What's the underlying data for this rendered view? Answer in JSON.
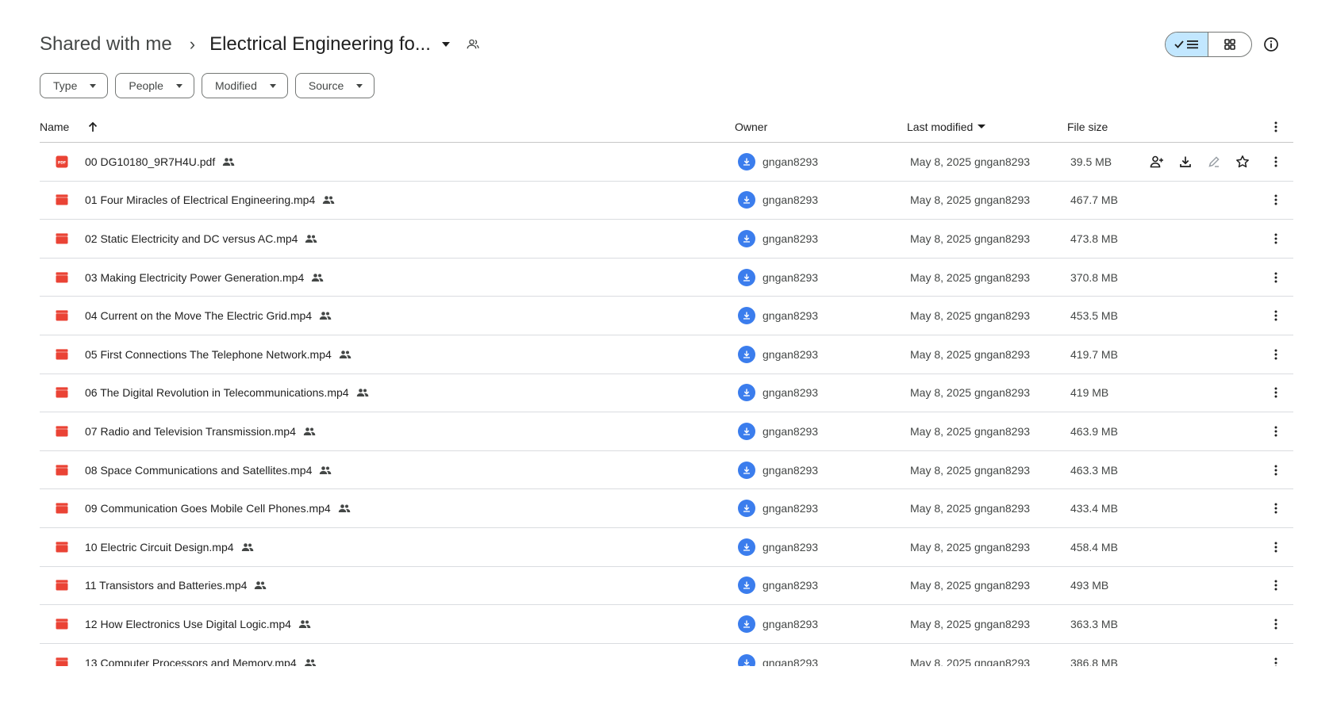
{
  "breadcrumb": {
    "root": "Shared with me",
    "separator": "›",
    "folder": "Electrical Engineering fo..."
  },
  "filters": [
    "Type",
    "People",
    "Modified",
    "Source"
  ],
  "columns": {
    "name": "Name",
    "owner": "Owner",
    "last_modified": "Last modified",
    "file_size": "File size"
  },
  "colors": {
    "accent_selected": "#c2e7ff",
    "file_icon_red": "#ea4335",
    "avatar_blue": "#3b7ded"
  },
  "files": [
    {
      "icon": "pdf-icon",
      "name": "00 DG10180_9R7H4U.pdf",
      "owner": "gngan8293",
      "modified": "May 8, 2025 gngan8293",
      "size": "39.5 MB"
    },
    {
      "icon": "video-icon",
      "name": "01 Four Miracles of Electrical Engineering.mp4",
      "owner": "gngan8293",
      "modified": "May 8, 2025 gngan8293",
      "size": "467.7 MB"
    },
    {
      "icon": "video-icon",
      "name": "02 Static Electricity and DC versus AC.mp4",
      "owner": "gngan8293",
      "modified": "May 8, 2025 gngan8293",
      "size": "473.8 MB"
    },
    {
      "icon": "video-icon",
      "name": "03 Making Electricity Power Generation.mp4",
      "owner": "gngan8293",
      "modified": "May 8, 2025 gngan8293",
      "size": "370.8 MB"
    },
    {
      "icon": "video-icon",
      "name": "04 Current on the Move The Electric Grid.mp4",
      "owner": "gngan8293",
      "modified": "May 8, 2025 gngan8293",
      "size": "453.5 MB"
    },
    {
      "icon": "video-icon",
      "name": "05 First Connections The Telephone Network.mp4",
      "owner": "gngan8293",
      "modified": "May 8, 2025 gngan8293",
      "size": "419.7 MB"
    },
    {
      "icon": "video-icon",
      "name": "06 The Digital Revolution in Telecommunications.mp4",
      "owner": "gngan8293",
      "modified": "May 8, 2025 gngan8293",
      "size": "419 MB"
    },
    {
      "icon": "video-icon",
      "name": "07 Radio and Television Transmission.mp4",
      "owner": "gngan8293",
      "modified": "May 8, 2025 gngan8293",
      "size": "463.9 MB"
    },
    {
      "icon": "video-icon",
      "name": "08 Space Communications and Satellites.mp4",
      "owner": "gngan8293",
      "modified": "May 8, 2025 gngan8293",
      "size": "463.3 MB"
    },
    {
      "icon": "video-icon",
      "name": "09 Communication Goes Mobile Cell Phones.mp4",
      "owner": "gngan8293",
      "modified": "May 8, 2025 gngan8293",
      "size": "433.4 MB"
    },
    {
      "icon": "video-icon",
      "name": "10 Electric Circuit Design.mp4",
      "owner": "gngan8293",
      "modified": "May 8, 2025 gngan8293",
      "size": "458.4 MB"
    },
    {
      "icon": "video-icon",
      "name": "11 Transistors and Batteries.mp4",
      "owner": "gngan8293",
      "modified": "May 8, 2025 gngan8293",
      "size": "493 MB"
    },
    {
      "icon": "video-icon",
      "name": "12 How Electronics Use Digital Logic.mp4",
      "owner": "gngan8293",
      "modified": "May 8, 2025 gngan8293",
      "size": "363.3 MB"
    },
    {
      "icon": "video-icon",
      "name": "13 Computer Processors and Memory.mp4",
      "owner": "gngan8293",
      "modified": "May 8, 2025 gngan8293",
      "size": "386.8 MB"
    }
  ]
}
